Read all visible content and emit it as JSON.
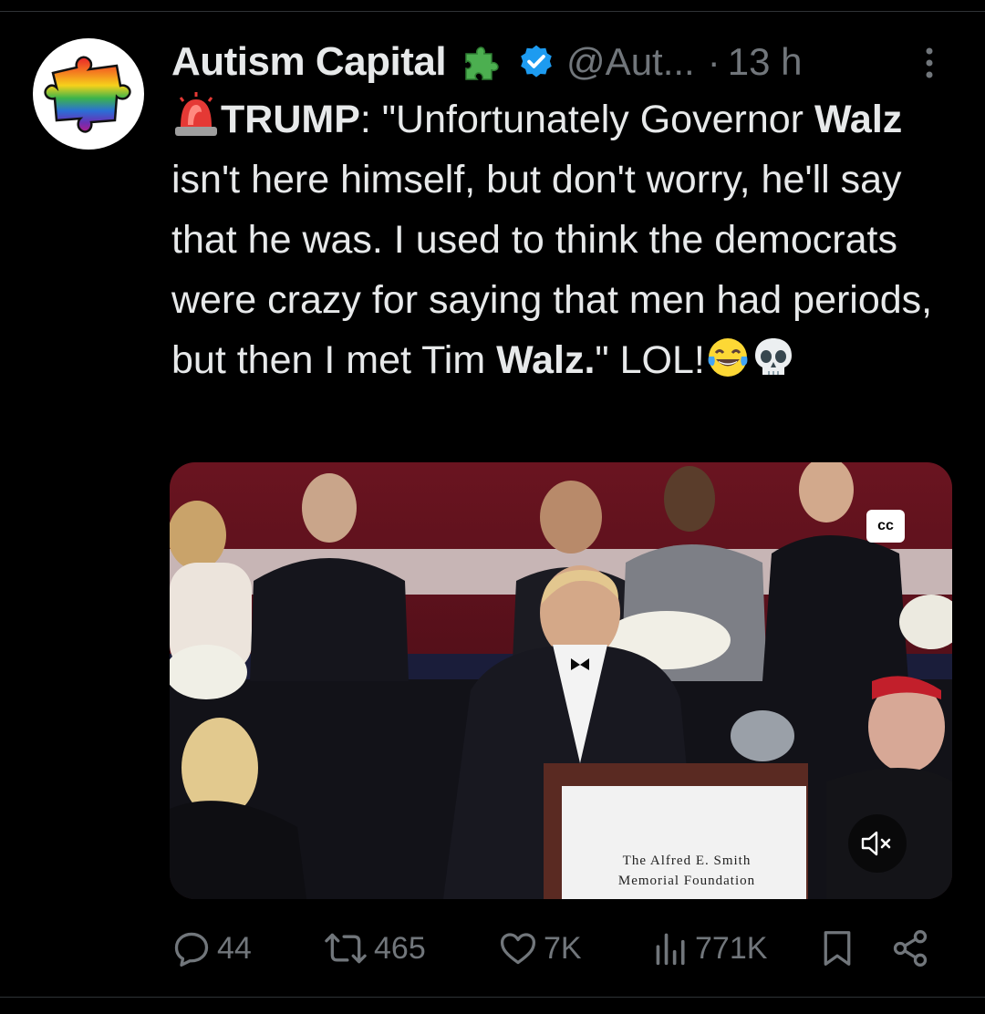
{
  "tweet": {
    "author_name": "Autism Capital",
    "handle": "@Aut...",
    "dot": "·",
    "time": "13 h",
    "text": {
      "speaker": "TRUMP",
      "after_speaker": ": \"Unfortunately Governor ",
      "bold1": "Walz",
      "middle": " isn't here himself, but don't worry, he'll say that he was. I used to think the democrats were crazy for saying that men had periods, but then I met Tim ",
      "bold2": "Walz.",
      "end": "\" LOL!"
    },
    "icons": [
      "rotating-light-icon",
      "face-with-tears-of-joy-icon",
      "skull-icon"
    ]
  },
  "media": {
    "cc_label": "cc",
    "podium_line1": "The Alfred E. Smith",
    "podium_line2": "Memorial Foundation"
  },
  "actions": {
    "replies": "44",
    "reposts": "465",
    "likes": "7K",
    "views": "771K"
  },
  "colors": {
    "background": "#000000",
    "text": "#e7e9ea",
    "muted": "#71767b",
    "verified": "#1d9bf0"
  }
}
